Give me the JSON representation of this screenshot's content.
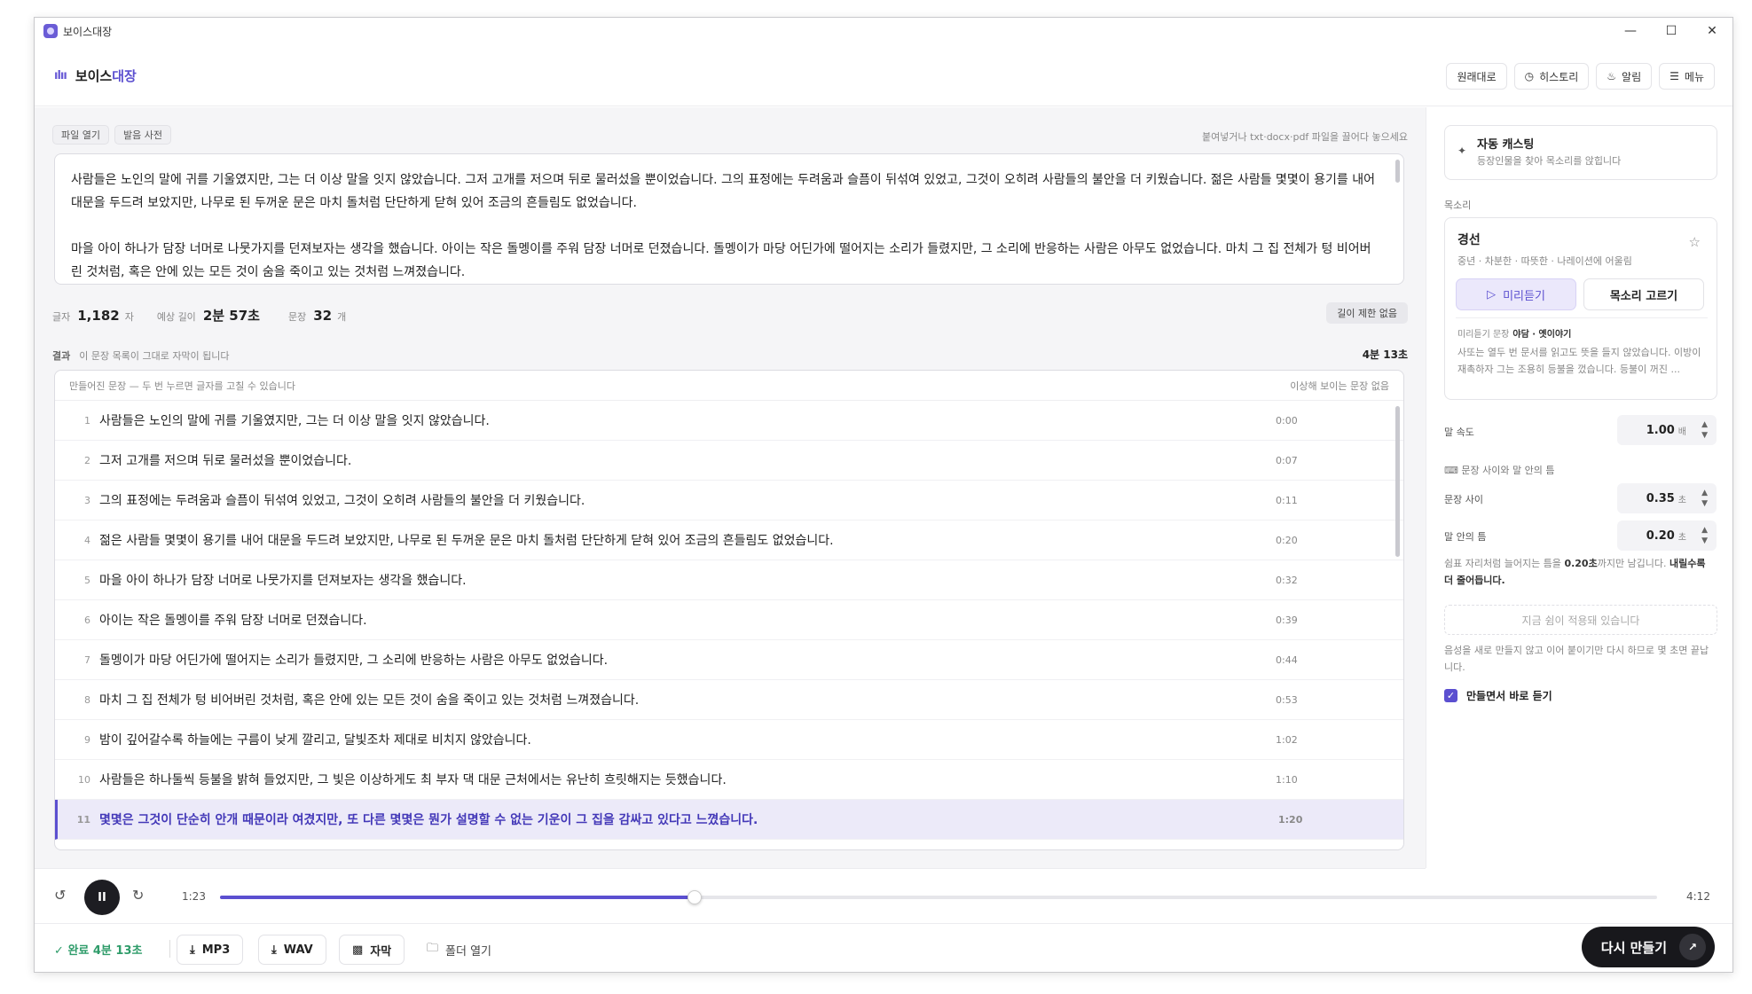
{
  "window": {
    "title": "보이스대장"
  },
  "header": {
    "brand_main": "보이스",
    "brand_accent": "대장",
    "buttons": [
      "원래대로",
      "히스토리",
      "알림",
      "메뉴"
    ]
  },
  "editor": {
    "toolbar": [
      "파일 열기",
      "발음 사전"
    ],
    "drop_hint": "붙여넣거나 txt·docx·pdf 파일을 끌어다 놓으세요",
    "paragraphs": [
      "사람들은 노인의 말에 귀를 기울였지만, 그는 더 이상 말을 잇지 않았습니다. 그저 고개를 저으며 뒤로 물러섰을 뿐이었습니다. 그의 표정에는 두려움과 슬픔이 뒤섞여 있었고, 그것이 오히려 사람들의 불안을 더 키웠습니다. 젊은 사람들 몇몇이 용기를 내어 대문을 두드려 보았지만, 나무로 된 두꺼운 문은 마치 돌처럼 단단하게 닫혀 있어 조금의 흔들림도 없었습니다.",
      "마을 아이 하나가 담장 너머로 나뭇가지를 던져보자는 생각을 했습니다. 아이는 작은 돌멩이를 주워 담장 너머로 던졌습니다. 돌멩이가 마당 어딘가에 떨어지는 소리가 들렸지만, 그 소리에 반응하는 사람은 아무도 없었습니다. 마치 그 집 전체가 텅 비어버린 것처럼, 혹은 안에 있는 모든 것이 숨을 죽이고 있는 것처럼 느껴졌습니다."
    ]
  },
  "stats": {
    "chars_label": "글자",
    "chars_value": "1,182",
    "chars_unit": "자",
    "length_label": "예상 길이",
    "length_value": "2분 57초",
    "sentences_label": "문장",
    "sentences_value": "32",
    "sentences_unit": "개",
    "limit_chip": "길이 제한 없음"
  },
  "result": {
    "label": "결과",
    "hint": "이 문장 목록이 그대로 자막이 됩니다",
    "duration": "4분 13초",
    "list_header_left": "만들어진 문장 — 두 번 누르면 글자를 고칠 수 있습니다",
    "list_header_right": "이상해 보이는 문장 없음",
    "rows": [
      {
        "num": "1",
        "text": "사람들은 노인의 말에 귀를 기울였지만, 그는 더 이상 말을 잇지 않았습니다.",
        "time": "0:00"
      },
      {
        "num": "2",
        "text": "그저 고개를 저으며 뒤로 물러섰을 뿐이었습니다.",
        "time": "0:07"
      },
      {
        "num": "3",
        "text": "그의 표정에는 두려움과 슬픔이 뒤섞여 있었고, 그것이 오히려 사람들의 불안을 더 키웠습니다.",
        "time": "0:11"
      },
      {
        "num": "4",
        "text": "젊은 사람들 몇몇이 용기를 내어 대문을 두드려 보았지만, 나무로 된 두꺼운 문은 마치 돌처럼 단단하게 닫혀 있어 조금의 흔들림도 없었습니다.",
        "time": "0:20"
      },
      {
        "num": "5",
        "text": "마을 아이 하나가 담장 너머로 나뭇가지를 던져보자는 생각을 했습니다.",
        "time": "0:32"
      },
      {
        "num": "6",
        "text": "아이는 작은 돌멩이를 주워 담장 너머로 던졌습니다.",
        "time": "0:39"
      },
      {
        "num": "7",
        "text": "돌멩이가 마당 어딘가에 떨어지는 소리가 들렸지만, 그 소리에 반응하는 사람은 아무도 없었습니다.",
        "time": "0:44"
      },
      {
        "num": "8",
        "text": "마치 그 집 전체가 텅 비어버린 것처럼, 혹은 안에 있는 모든 것이 숨을 죽이고 있는 것처럼 느껴졌습니다.",
        "time": "0:53"
      },
      {
        "num": "9",
        "text": "밤이 깊어갈수록 하늘에는 구름이 낮게 깔리고, 달빛조차 제대로 비치지 않았습니다.",
        "time": "1:02"
      },
      {
        "num": "10",
        "text": "사람들은 하나둘씩 등불을 밝혀 들었지만, 그 빛은 이상하게도 최 부자 댁 대문 근처에서는 유난히 흐릿해지는 듯했습니다.",
        "time": "1:10"
      },
      {
        "num": "11",
        "text": "몇몇은 그것이 단순히 안개 때문이라 여겼지만, 또 다른 몇몇은 뭔가 설명할 수 없는 기운이 그 집을 감싸고 있다고 느꼈습니다.",
        "time": "1:20",
        "active": true
      }
    ]
  },
  "player": {
    "current": "1:23",
    "total": "4:12",
    "progress": 0.33,
    "play_glyph": "II"
  },
  "bottom": {
    "done_label": "완료 4분 13초",
    "mp3": "MP3",
    "wav": "WAV",
    "subtitle": "자막",
    "folder": "폴더 열기",
    "remake": "다시 만들기"
  },
  "panel": {
    "auto_title": "자동 캐스팅",
    "auto_sub": "등장인물을 찾아 목소리를 앉힙니다",
    "voice_section": "목소리",
    "voice_name": "경선",
    "voice_desc": "중년 · 차분한 · 따뜻한 · 나레이션에 어울림",
    "preview_btn": "미리듣기",
    "choose_btn": "목소리 고르기",
    "preview_label": "미리듣기 문장",
    "preview_type": "야담 · 옛이야기",
    "preview_text": "사또는 열두 번 문서를 읽고도 뜻을 들지 않았습니다. 이방이 재촉하자 그는 조용히 등불을 껐습니다. 등불이 꺼진 ...",
    "speed_label": "말 속도",
    "speed_value": "1.00",
    "speed_unit": "배",
    "pause_section": "문장 사이와 말 안의 틈",
    "between_label": "문장 사이",
    "between_value": "0.35",
    "between_unit": "초",
    "inner_label": "말 안의 틈",
    "inner_value": "0.20",
    "inner_unit": "초",
    "note_pre": "쉼표 자리처럼 늘어지는 틈을 ",
    "note_bold": "0.20초",
    "note_mid": "까지만 남깁니다. ",
    "note_bold2": "내릴수록 더 줄어듭니다.",
    "applied": "지금 쉼이 적용돼 있습니다",
    "note2": "음성을 새로 만들지 않고 이어 붙이기만 다시 하므로 몇 초면 끝납니다.",
    "instant_play": "만들면서 바로 듣기"
  },
  "colors": {
    "accent": "#5b4fd0",
    "done": "#2f9c6a",
    "dark": "#18181c"
  }
}
